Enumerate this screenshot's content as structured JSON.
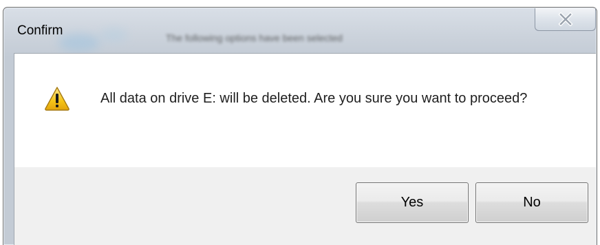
{
  "window": {
    "title": "Confirm",
    "background_caption": "The following options have been selected"
  },
  "dialog": {
    "icon": "warning-icon",
    "message": "All data on drive E: will be deleted.  Are you sure you want to proceed?"
  },
  "buttons": {
    "yes_label": "Yes",
    "no_label": "No",
    "close_icon": "close-icon"
  },
  "colors": {
    "frame": "#cdd4dd",
    "client_footer": "#f0f0f0",
    "warning_yellow": "#f5c518"
  }
}
